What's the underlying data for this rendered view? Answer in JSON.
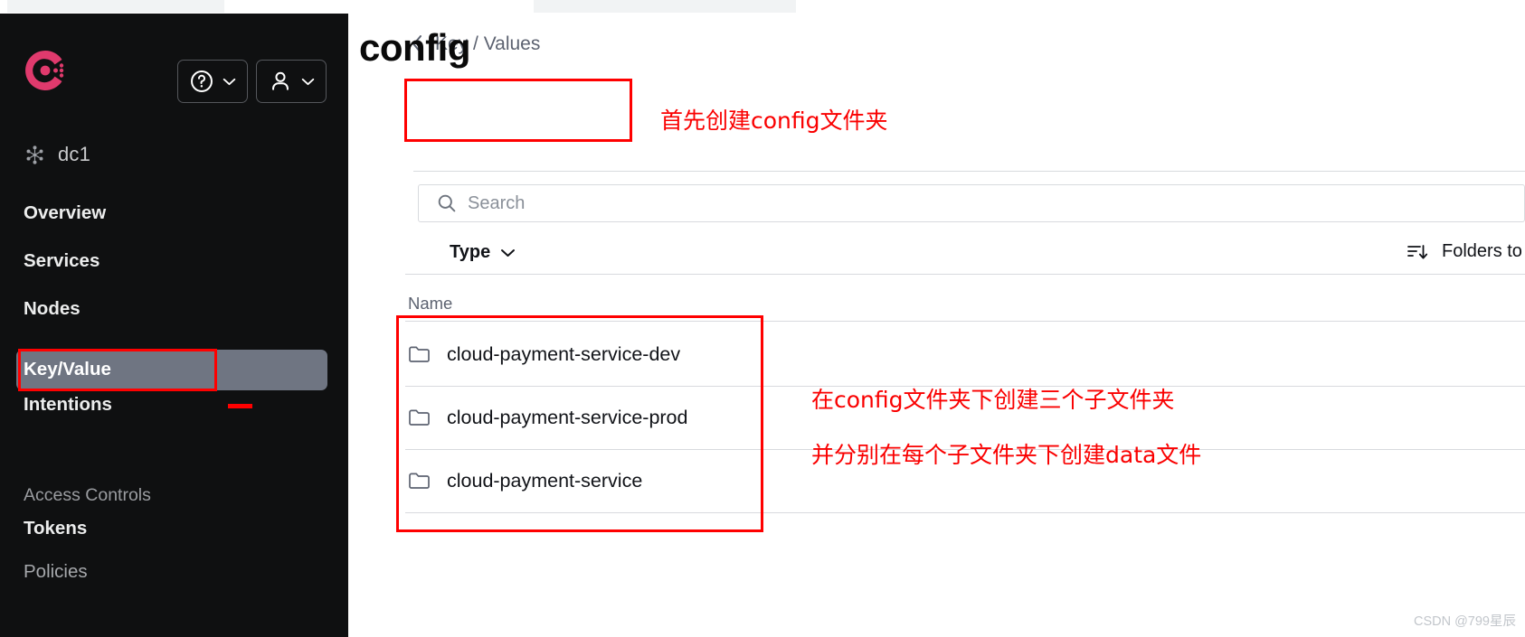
{
  "browser": {
    "tabs": [
      {
        "label": "",
        "dot": "#18b663"
      },
      {
        "label": "",
        "dot": ""
      }
    ]
  },
  "sidebar": {
    "logo_icon": "consul-logo-icon",
    "help_button": {
      "icon": "question-circle-icon",
      "chevron": "chevron-down-icon"
    },
    "user_button": {
      "icon": "user-icon",
      "chevron": "chevron-down-icon"
    },
    "datacenter": {
      "icon": "datacenter-icon",
      "label": "dc1"
    },
    "items": [
      {
        "label": "Overview",
        "type": "link",
        "state": "normal"
      },
      {
        "label": "Services",
        "type": "link",
        "state": "normal"
      },
      {
        "label": "Nodes",
        "type": "link",
        "state": "normal"
      },
      {
        "label": "Key/Value",
        "type": "link",
        "state": "active"
      },
      {
        "label": "Intentions",
        "type": "link",
        "state": "normal"
      },
      {
        "label": "Access Controls",
        "type": "group",
        "state": "group"
      },
      {
        "label": "Tokens",
        "type": "link",
        "state": "normal"
      },
      {
        "label": "Policies",
        "type": "link",
        "state": "dim"
      }
    ]
  },
  "main": {
    "breadcrumb": {
      "back_icon": "chevron-left-icon",
      "label": "Key / Values"
    },
    "page_title": "config",
    "search": {
      "icon": "search-icon",
      "placeholder": "Search",
      "value": ""
    },
    "type_filter": {
      "label": "Type",
      "icon": "chevron-down-icon"
    },
    "sort_control": {
      "icon": "sort-descending-icon",
      "label": "Folders to"
    },
    "table": {
      "columns": [
        "Name"
      ],
      "rows": [
        {
          "icon": "folder-icon",
          "name": "cloud-payment-service-dev"
        },
        {
          "icon": "folder-icon",
          "name": "cloud-payment-service-prod"
        },
        {
          "icon": "folder-icon",
          "name": "cloud-payment-service"
        }
      ]
    }
  },
  "annotations": {
    "title_note": "首先创建config文件夹",
    "list_note_1": "在config文件夹下创建三个子文件夹",
    "list_note_2": "并分别在每个子文件夹下创建data文件",
    "color": "#fa0000"
  },
  "watermark": "CSDN @799星辰"
}
